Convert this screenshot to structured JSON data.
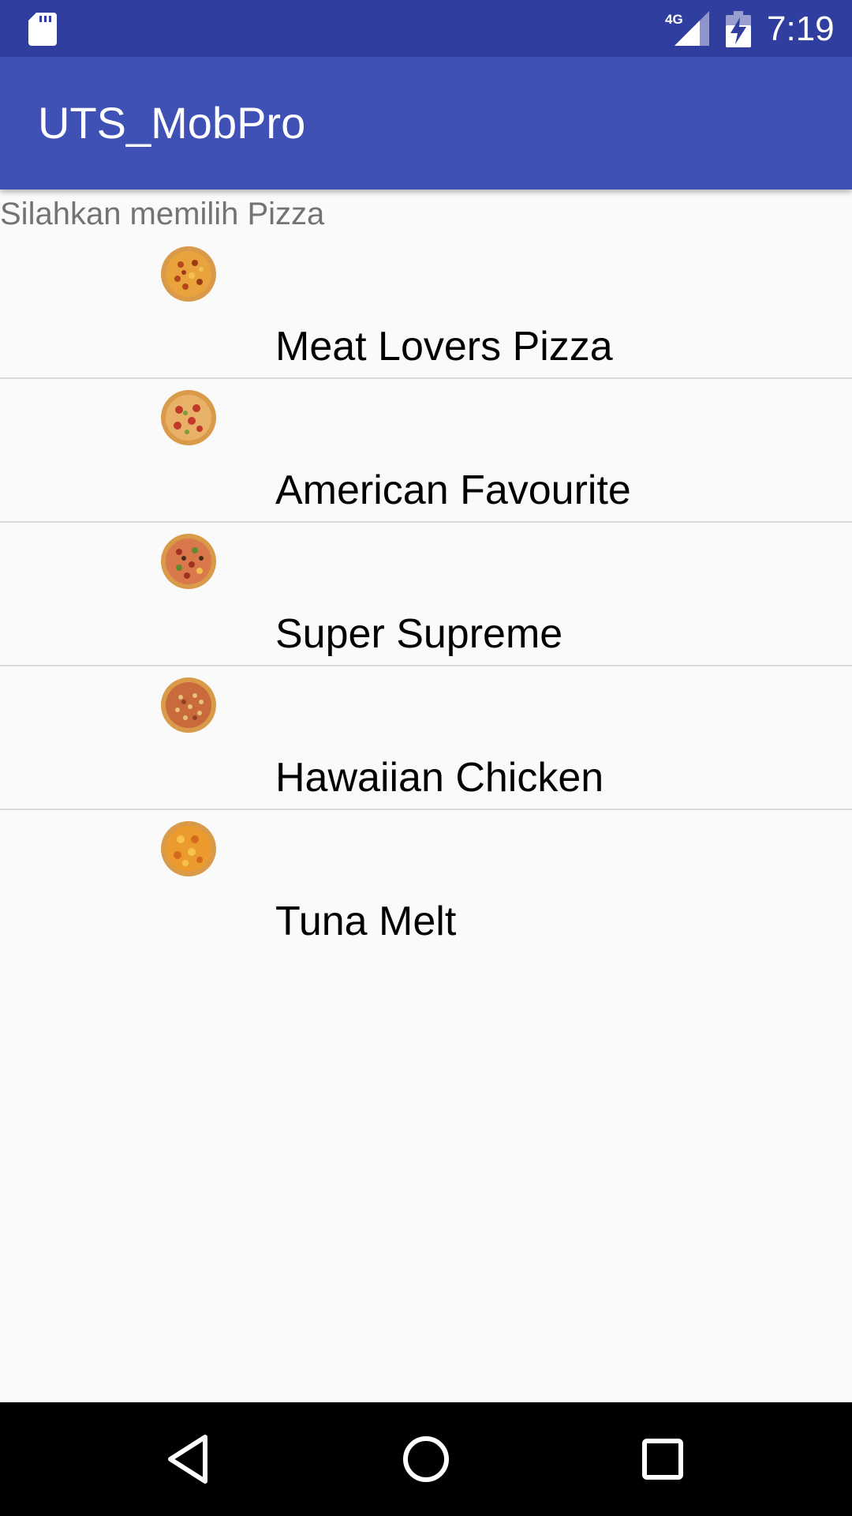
{
  "status_bar": {
    "time": "7:19",
    "network": "4G",
    "icons": [
      "sd-card-icon",
      "signal-icon",
      "battery-charging-icon"
    ]
  },
  "app_bar": {
    "title": "UTS_MobPro"
  },
  "prompt": "Silahkan memilih Pizza",
  "pizzas": [
    {
      "name": "Meat Lovers Pizza",
      "icon": "pizza-icon"
    },
    {
      "name": "American Favourite",
      "icon": "pizza-icon"
    },
    {
      "name": "Super Supreme",
      "icon": "pizza-icon"
    },
    {
      "name": "Hawaiian Chicken",
      "icon": "pizza-icon"
    },
    {
      "name": "Tuna Melt",
      "icon": "pizza-icon"
    }
  ],
  "nav_bar": {
    "icons": [
      "back-icon",
      "home-icon",
      "recents-icon"
    ]
  },
  "colors": {
    "status_bar": "#303f9f",
    "app_bar": "#3f51b5",
    "background": "#fafafa",
    "divider": "#d9d9d9",
    "prompt_text": "#737373"
  }
}
